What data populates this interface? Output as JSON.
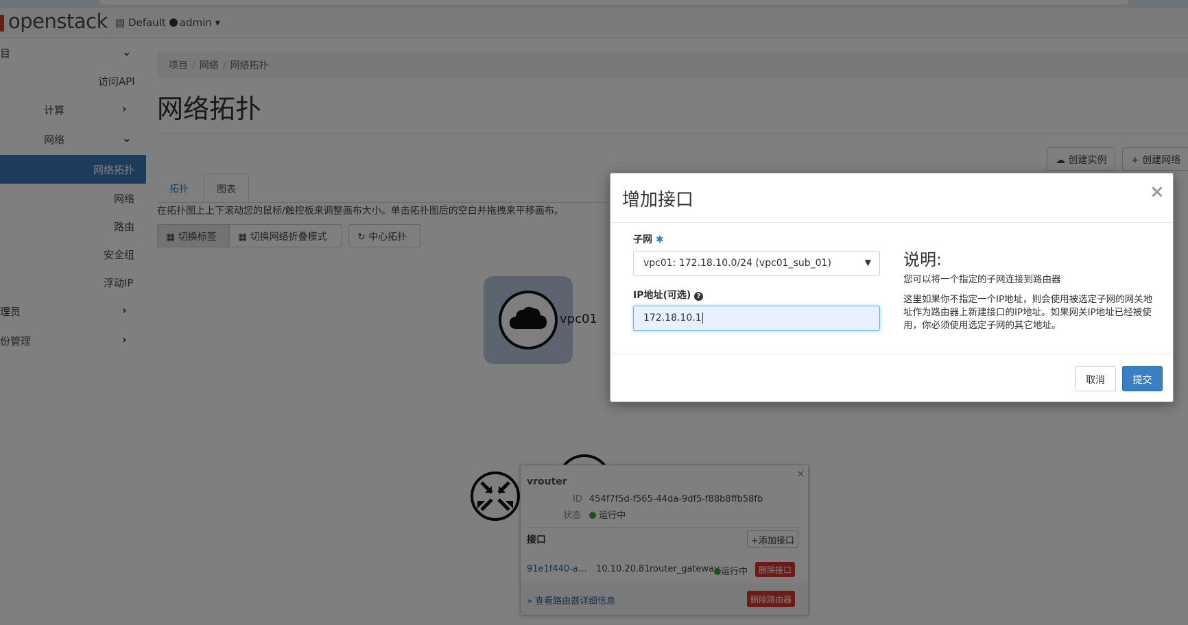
{
  "brand": {
    "logo_text": "openstack",
    "logo_suffix": "."
  },
  "project_selector": {
    "domain": "Default",
    "user": "admin"
  },
  "sidebar": {
    "items": [
      {
        "label": "目",
        "expanded": true
      },
      {
        "label": "访问API"
      },
      {
        "label": "计算"
      },
      {
        "label": "网络"
      },
      {
        "label": "网络拓扑",
        "active": true
      },
      {
        "label": "网络"
      },
      {
        "label": "路由"
      },
      {
        "label": "安全组"
      },
      {
        "label": "浮动IP"
      },
      {
        "label": "理员"
      },
      {
        "label": "份管理"
      }
    ]
  },
  "breadcrumb": [
    "项目",
    "网络",
    "网络拓扑"
  ],
  "page_title": "网络拓扑",
  "actions": {
    "create_instance": "创建实例",
    "create_network": "创建网络"
  },
  "tabs": {
    "topology": "拓扑",
    "graph": "图表"
  },
  "help_text": "在拓扑图上上下滚动您的鼠标/触控板来调整画布大小。单击拓扑图后的空白并拖拽来平移画布。",
  "toolbar": {
    "toggle_labels": "切换标签",
    "toggle_collapse": "切换网络折叠模式",
    "center": "中心拓扑"
  },
  "topology": {
    "network_name": "vpc01"
  },
  "router_popup": {
    "name": "vrouter",
    "id_label": "ID",
    "id_value": "454f7f5d-f565-44da-9df5-f88b8ffb58fb",
    "status_label": "状态",
    "status_value": "运行中",
    "interfaces_title": "接口",
    "add_interface": "添加接口",
    "interface": {
      "id": "91e1f440-a…",
      "ip": "10.10.20.81",
      "type": "router_gateway",
      "status": "运行中",
      "delete": "删除接口"
    },
    "view_details": "» 查看路由器详细信息",
    "delete_router": "删除路由器"
  },
  "modal": {
    "title": "增加接口",
    "close": "×",
    "subnet_label": "子网",
    "required_mark": "✱",
    "subnet_value": "vpc01: 172.18.10.0/24 (vpc01_sub_01)",
    "ip_label": "IP地址(可选)",
    "ip_value": "172.18.10.1",
    "desc_title": "说明:",
    "desc_line1": "您可以将一个指定的子网连接到路由器",
    "desc_line2": "这里如果你不指定一个IP地址，则会使用被选定子网的网关地址作为路由器上新建接口的IP地址。如果网关IP地址已经被使用，你必须使用选定子网的其它地址。",
    "cancel": "取消",
    "submit": "提交"
  },
  "colors": {
    "accent": "#3a78b7",
    "danger": "#d9362f",
    "success": "#3c9d3c"
  }
}
